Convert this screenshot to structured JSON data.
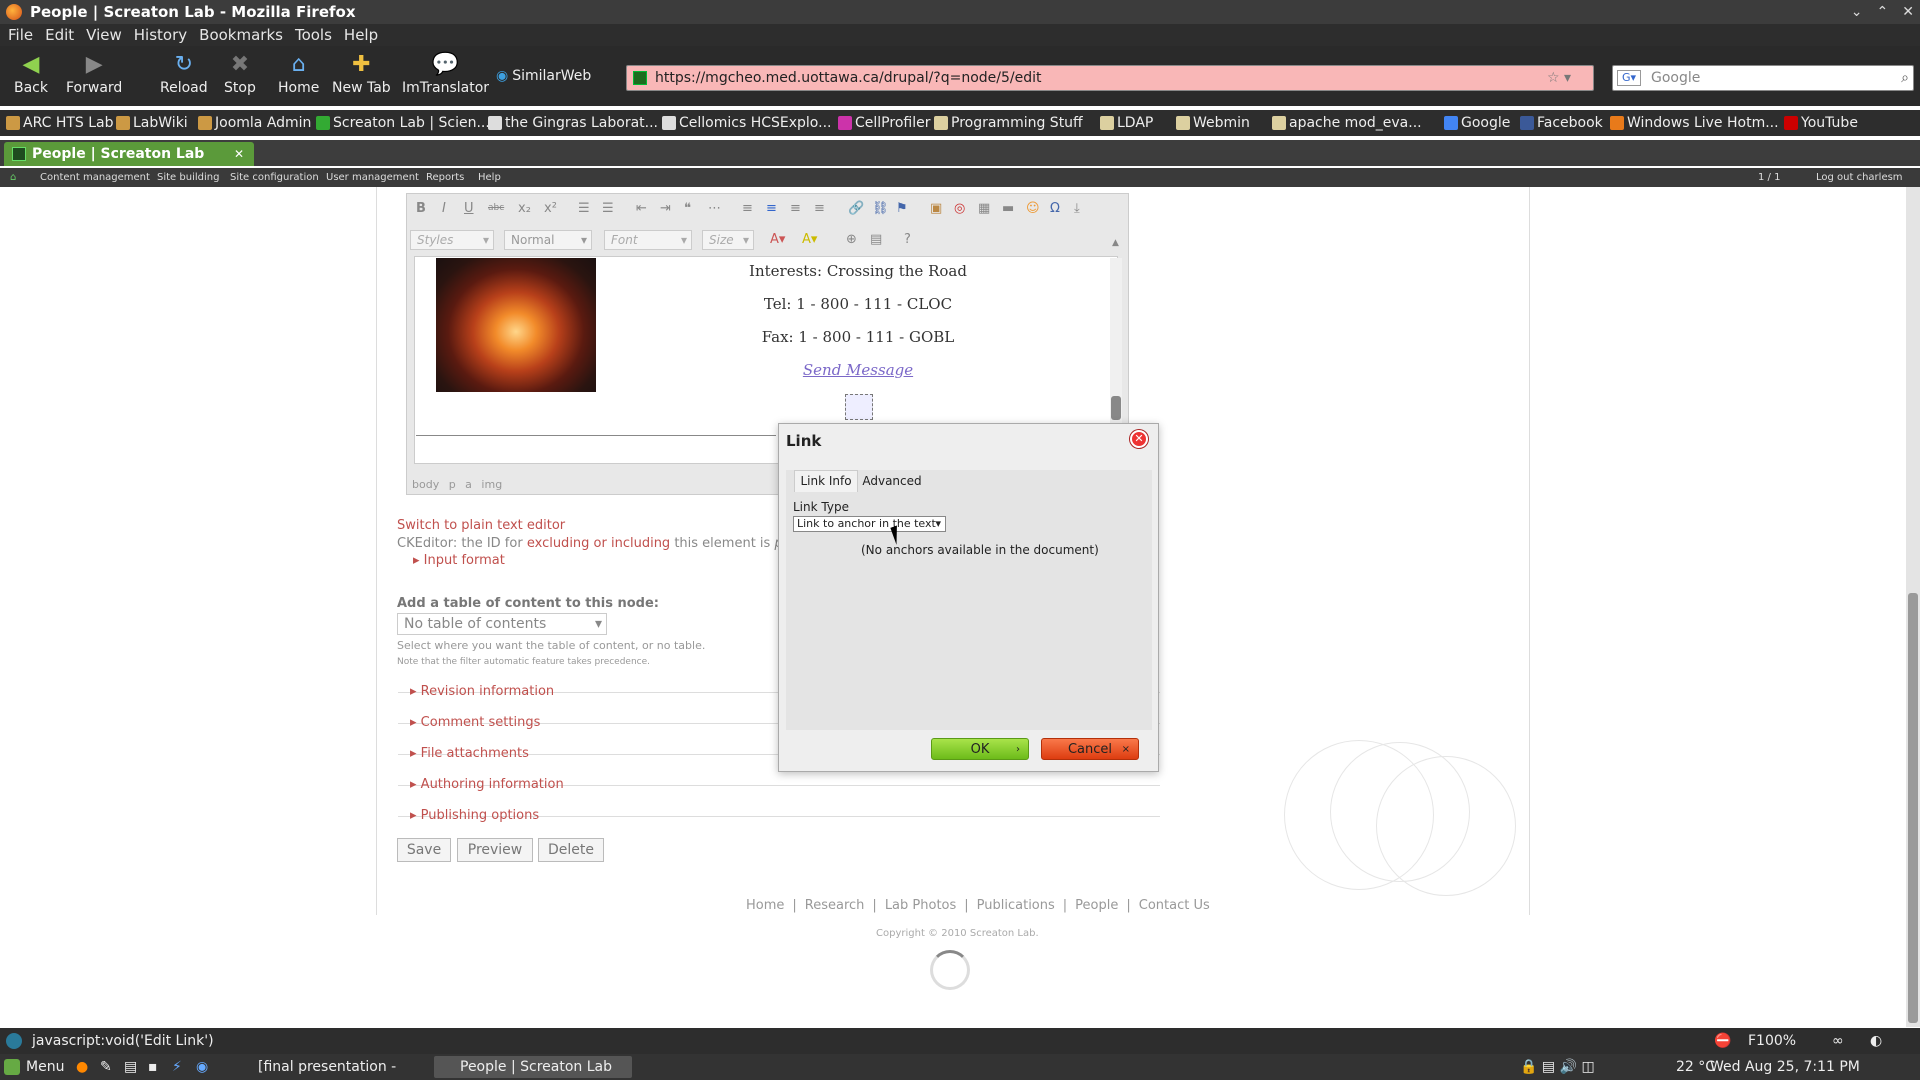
{
  "window": {
    "title": "People | Screaton Lab - Mozilla Firefox",
    "controls": [
      "⌄",
      "⌃",
      "✕"
    ]
  },
  "menu": [
    "File",
    "Edit",
    "View",
    "History",
    "Bookmarks",
    "Tools",
    "Help"
  ],
  "nav": {
    "back": "Back",
    "forward": "Forward",
    "reload": "Reload",
    "stop": "Stop",
    "home": "Home",
    "newtab": "New Tab",
    "translator": "ImTranslator",
    "similarweb": "SimilarWeb"
  },
  "url": "https://mgcheo.med.uottawa.ca/drupal/?q=node/5/edit",
  "search_placeholder": "Google",
  "bookmarks": [
    "ARC HTS Lab",
    "LabWiki",
    "Joomla Admin",
    "Screaton Lab | Scien...",
    "the Gingras Laborat...",
    "Cellomics HCSExplo...",
    "CellProfiler",
    "Programming Stuff",
    "LDAP",
    "Webmin",
    "apache mod_eva...",
    "Google",
    "Facebook",
    "Windows Live Hotm...",
    "YouTube"
  ],
  "tab": {
    "title": "People | Screaton Lab"
  },
  "admin": {
    "items": [
      "Content management",
      "Site building",
      "Site configuration",
      "User management",
      "Reports",
      "Help"
    ],
    "page_count": "1 / 1",
    "logout": "Log out charlesm"
  },
  "editor": {
    "styles": "Styles",
    "format": "Normal",
    "font": "Font",
    "size": "Size",
    "lines": [
      "Interests: Crossing the Road",
      "Tel: 1 - 800 - 111 - CLOC",
      "Fax: 1 - 800 - 111 - GOBL"
    ],
    "link": "Send Message",
    "path": "body p a img"
  },
  "below_editor": {
    "switch": "Switch to plain text editor",
    "ckeditor_prefix": "CKEditor: the ID for",
    "ckeditor_link": "excluding or including",
    "ckeditor_suffix": "this element is",
    "ckeditor_id": "page@",
    "input_format": "Input format",
    "toc_label": "Add a table of content to this node:",
    "toc_value": "No table of contents",
    "toc_help1": "Select where you want the table of content, or no table.",
    "toc_help2": "Note that the filter automatic feature takes precedence."
  },
  "fieldsets": [
    "Revision information",
    "Comment settings",
    "File attachments",
    "Authoring information",
    "Publishing options"
  ],
  "buttons": {
    "save": "Save",
    "preview": "Preview",
    "delete": "Delete"
  },
  "footer": {
    "links": [
      "Home",
      "Research",
      "Lab Photos",
      "Publications",
      "People",
      "Contact Us"
    ],
    "copyright": "Copyright © 2010 Screaton Lab."
  },
  "dialog": {
    "title": "Link",
    "tabs": [
      "Link Info",
      "Advanced"
    ],
    "link_type_label": "Link Type",
    "link_type_value": "Link to anchor in the text",
    "no_anchors": "(No anchors available in the document)",
    "ok": "OK",
    "cancel": "Cancel"
  },
  "status": "javascript:void('Edit Link')",
  "zoom": "F100%",
  "taskbar": {
    "menu": "Menu",
    "task1": "[final presentation - Fil...",
    "task2": "People | Screaton Lab -...",
    "temp": "22 °C",
    "clock": "Wed Aug 25, 7:11 PM"
  },
  "colors": {
    "accent_link": "#c0504d",
    "url_bg": "#f9b7b7",
    "ok": "#6cbb1a",
    "cancel": "#dd3c10"
  }
}
